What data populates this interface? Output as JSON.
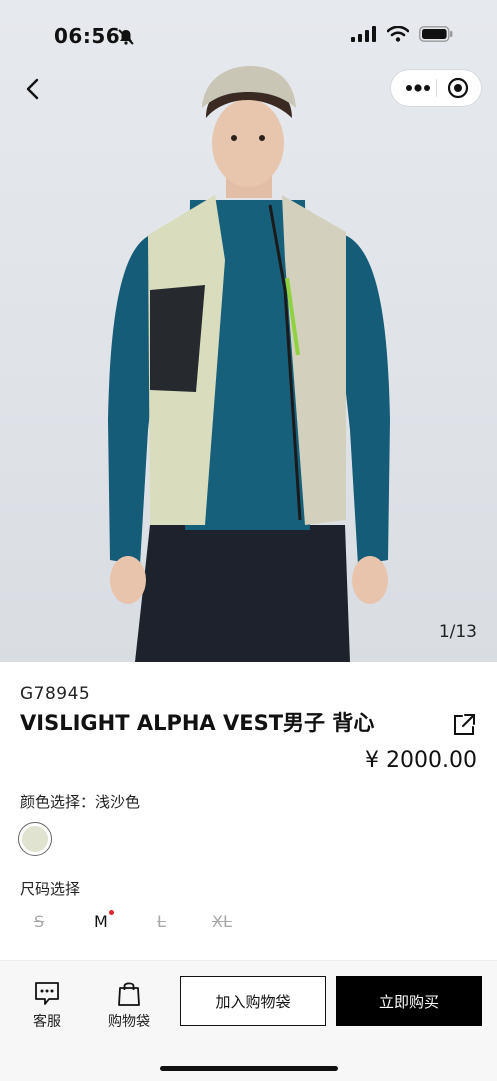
{
  "status_bar": {
    "time": "06:56"
  },
  "gallery": {
    "counter": "1/13",
    "image_alt": "Model wearing light khaki vest over teal fleece and black shorts"
  },
  "product": {
    "sku": "G78945",
    "title": "VISLIGHT ALPHA VEST男子 背心",
    "price": "¥ 2000.00",
    "color_label": "颜色选择：浅沙色",
    "swatch_color": "#dfe3cf",
    "size_label": "尺码选择",
    "sizes": [
      {
        "label": "S",
        "available": false
      },
      {
        "label": "M",
        "available": true,
        "selected": true
      },
      {
        "label": "L",
        "available": false
      },
      {
        "label": "XL",
        "available": false
      }
    ]
  },
  "bottom_bar": {
    "service_label": "客服",
    "cart_label": "购物袋",
    "add_to_cart": "加入购物袋",
    "buy_now": "立即购买"
  },
  "colors": {
    "accent": "#000000",
    "badge_dot": "#e0242a"
  }
}
